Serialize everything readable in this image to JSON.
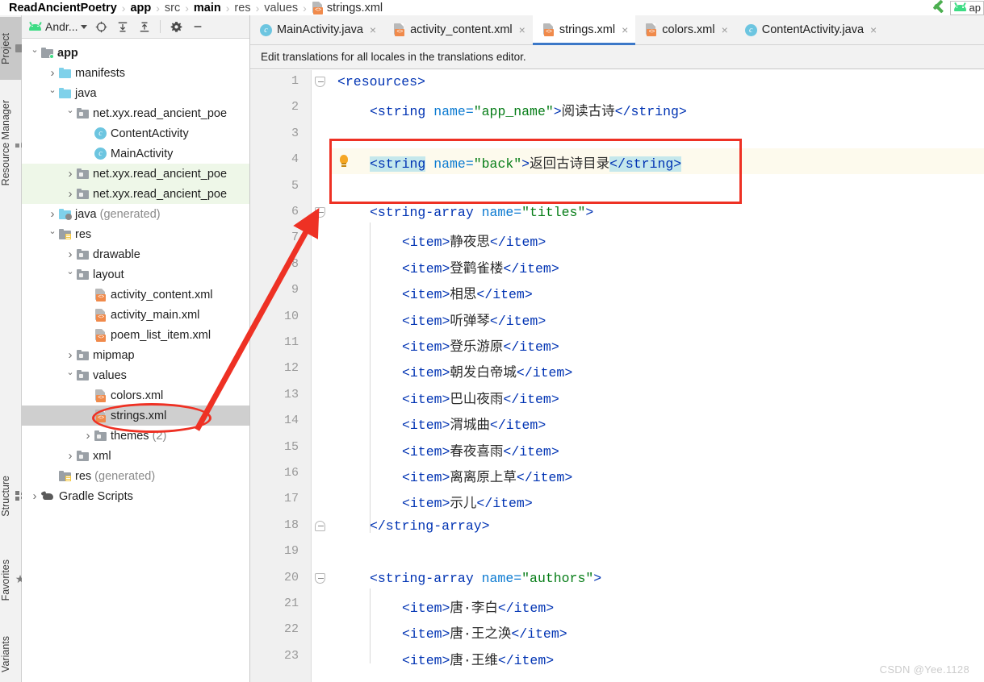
{
  "breadcrumb": {
    "items": [
      {
        "label": "ReadAncientPoetry",
        "style": "bold"
      },
      {
        "label": "app",
        "style": "bold"
      },
      {
        "label": "src",
        "style": "dim"
      },
      {
        "label": "main",
        "style": "bold"
      },
      {
        "label": "res",
        "style": "dim"
      },
      {
        "label": "values",
        "style": "dim"
      }
    ],
    "file": "strings.xml",
    "separator": "›"
  },
  "toolstrip": {
    "top": [
      {
        "label": "Project",
        "icon": "folder-icon",
        "active": true
      },
      {
        "label": "Resource Manager",
        "icon": "resource-icon",
        "active": false
      }
    ],
    "bottom": [
      {
        "label": "Structure",
        "icon": "structure-icon"
      },
      {
        "label": "Favorites",
        "icon": "star-icon"
      },
      {
        "label": "Variants",
        "icon": "none"
      }
    ]
  },
  "project_toolbar": {
    "selector_label": "Andr...",
    "buttons": [
      {
        "name": "locate-icon",
        "glyph": "⊕"
      },
      {
        "name": "expand-all-icon",
        "glyph": "≡"
      },
      {
        "name": "collapse-all-icon",
        "glyph": "≡"
      },
      {
        "name": "settings-gear-icon",
        "glyph": "⚙"
      },
      {
        "name": "hide-panel-icon",
        "glyph": "−"
      }
    ]
  },
  "tree": [
    {
      "indent": 0,
      "arrow": "open",
      "icon": "module-folder",
      "label": "app",
      "bold": true,
      "state": "normal"
    },
    {
      "indent": 1,
      "arrow": "closed",
      "icon": "folder-blue",
      "label": "manifests",
      "bold": false,
      "state": "normal"
    },
    {
      "indent": 1,
      "arrow": "open",
      "icon": "folder-blue",
      "label": "java",
      "bold": false,
      "state": "normal"
    },
    {
      "indent": 2,
      "arrow": "open",
      "icon": "package",
      "label": "net.xyx.read_ancient_poe",
      "bold": false,
      "state": "normal"
    },
    {
      "indent": 3,
      "arrow": "none",
      "icon": "java-class",
      "label": "ContentActivity",
      "bold": false,
      "state": "normal"
    },
    {
      "indent": 3,
      "arrow": "none",
      "icon": "java-class",
      "label": "MainActivity",
      "bold": false,
      "state": "normal"
    },
    {
      "indent": 2,
      "arrow": "closed",
      "icon": "package",
      "label": "net.xyx.read_ancient_poe",
      "bold": false,
      "state": "green"
    },
    {
      "indent": 2,
      "arrow": "closed",
      "icon": "package",
      "label": "net.xyx.read_ancient_poe",
      "bold": false,
      "state": "green"
    },
    {
      "indent": 1,
      "arrow": "closed",
      "icon": "folder-gen",
      "label": "java",
      "suffix": " (generated)",
      "bold": false,
      "state": "normal"
    },
    {
      "indent": 1,
      "arrow": "open",
      "icon": "folder-res",
      "label": "res",
      "bold": false,
      "state": "normal"
    },
    {
      "indent": 2,
      "arrow": "closed",
      "icon": "package",
      "label": "drawable",
      "bold": false,
      "state": "normal"
    },
    {
      "indent": 2,
      "arrow": "open",
      "icon": "package",
      "label": "layout",
      "bold": false,
      "state": "normal"
    },
    {
      "indent": 3,
      "arrow": "none",
      "icon": "xml-file",
      "label": "activity_content.xml",
      "bold": false,
      "state": "normal"
    },
    {
      "indent": 3,
      "arrow": "none",
      "icon": "xml-file",
      "label": "activity_main.xml",
      "bold": false,
      "state": "normal"
    },
    {
      "indent": 3,
      "arrow": "none",
      "icon": "xml-file",
      "label": "poem_list_item.xml",
      "bold": false,
      "state": "normal"
    },
    {
      "indent": 2,
      "arrow": "closed",
      "icon": "package",
      "label": "mipmap",
      "bold": false,
      "state": "normal"
    },
    {
      "indent": 2,
      "arrow": "open",
      "icon": "package",
      "label": "values",
      "bold": false,
      "state": "normal"
    },
    {
      "indent": 3,
      "arrow": "none",
      "icon": "xml-file",
      "label": "colors.xml",
      "bold": false,
      "state": "normal"
    },
    {
      "indent": 3,
      "arrow": "none",
      "icon": "xml-file",
      "label": "strings.xml",
      "bold": false,
      "state": "selected"
    },
    {
      "indent": 3,
      "arrow": "closed",
      "icon": "package",
      "label": "themes",
      "suffix": " (2)",
      "bold": false,
      "state": "normal"
    },
    {
      "indent": 2,
      "arrow": "closed",
      "icon": "package",
      "label": "xml",
      "bold": false,
      "state": "normal"
    },
    {
      "indent": 1,
      "arrow": "none",
      "icon": "folder-res",
      "label": "res",
      "suffix": " (generated)",
      "bold": false,
      "state": "normal"
    },
    {
      "indent": 0,
      "arrow": "closed",
      "icon": "gradle",
      "label": "Gradle Scripts",
      "bold": false,
      "state": "normal"
    }
  ],
  "editor_tabs": [
    {
      "label": "MainActivity.java",
      "icon": "java-class",
      "active": false
    },
    {
      "label": "activity_content.xml",
      "icon": "xml-file",
      "active": false
    },
    {
      "label": "strings.xml",
      "icon": "xml-file",
      "active": true
    },
    {
      "label": "colors.xml",
      "icon": "xml-file",
      "active": false
    },
    {
      "label": "ContentActivity.java",
      "icon": "java-class",
      "active": false
    }
  ],
  "notice": "Edit translations for all locales in the translations editor.",
  "code": {
    "highlighted_line": 4,
    "first_line": 1,
    "last_line": 23,
    "lines": [
      {
        "n": 1,
        "indent": 0,
        "fold": "top",
        "tokens": [
          {
            "t": "<resources>",
            "c": "t-tag"
          }
        ]
      },
      {
        "n": 2,
        "indent": 1,
        "tokens": [
          {
            "t": "<string ",
            "c": "t-tag"
          },
          {
            "t": "name=",
            "c": "t-attr"
          },
          {
            "t": "\"app_name\"",
            "c": "t-val"
          },
          {
            "t": ">",
            "c": "t-tag"
          },
          {
            "t": "阅读古诗",
            "c": "t-text"
          },
          {
            "t": "</string>",
            "c": "t-tag"
          }
        ]
      },
      {
        "n": 3,
        "indent": 0,
        "tokens": []
      },
      {
        "n": 4,
        "indent": 1,
        "bulb": true,
        "tokens": [
          {
            "t": "<string",
            "c": "t-tag",
            "hl": true
          },
          {
            "t": " ",
            "c": "t-tag"
          },
          {
            "t": "name=",
            "c": "t-attr"
          },
          {
            "t": "\"back\"",
            "c": "t-val"
          },
          {
            "t": ">",
            "c": "t-tag"
          },
          {
            "t": "返回古诗目录",
            "c": "t-text"
          },
          {
            "t": "</string>",
            "c": "t-tag",
            "hl": true
          }
        ]
      },
      {
        "n": 5,
        "indent": 0,
        "tokens": []
      },
      {
        "n": 6,
        "indent": 1,
        "fold": "top",
        "tokens": [
          {
            "t": "<string-array ",
            "c": "t-tag"
          },
          {
            "t": "name=",
            "c": "t-attr"
          },
          {
            "t": "\"titles\"",
            "c": "t-val"
          },
          {
            "t": ">",
            "c": "t-tag"
          }
        ]
      },
      {
        "n": 7,
        "indent": 2,
        "tokens": [
          {
            "t": "<item>",
            "c": "t-tag"
          },
          {
            "t": "静夜思",
            "c": "t-text"
          },
          {
            "t": "</item>",
            "c": "t-tag"
          }
        ]
      },
      {
        "n": 8,
        "indent": 2,
        "tokens": [
          {
            "t": "<item>",
            "c": "t-tag"
          },
          {
            "t": "登鹳雀楼",
            "c": "t-text"
          },
          {
            "t": "</item>",
            "c": "t-tag"
          }
        ]
      },
      {
        "n": 9,
        "indent": 2,
        "tokens": [
          {
            "t": "<item>",
            "c": "t-tag"
          },
          {
            "t": "相思",
            "c": "t-text"
          },
          {
            "t": "</item>",
            "c": "t-tag"
          }
        ]
      },
      {
        "n": 10,
        "indent": 2,
        "tokens": [
          {
            "t": "<item>",
            "c": "t-tag"
          },
          {
            "t": "听弹琴",
            "c": "t-text"
          },
          {
            "t": "</item>",
            "c": "t-tag"
          }
        ]
      },
      {
        "n": 11,
        "indent": 2,
        "tokens": [
          {
            "t": "<item>",
            "c": "t-tag"
          },
          {
            "t": "登乐游原",
            "c": "t-text"
          },
          {
            "t": "</item>",
            "c": "t-tag"
          }
        ]
      },
      {
        "n": 12,
        "indent": 2,
        "tokens": [
          {
            "t": "<item>",
            "c": "t-tag"
          },
          {
            "t": "朝发白帝城",
            "c": "t-text"
          },
          {
            "t": "</item>",
            "c": "t-tag"
          }
        ]
      },
      {
        "n": 13,
        "indent": 2,
        "tokens": [
          {
            "t": "<item>",
            "c": "t-tag"
          },
          {
            "t": "巴山夜雨",
            "c": "t-text"
          },
          {
            "t": "</item>",
            "c": "t-tag"
          }
        ]
      },
      {
        "n": 14,
        "indent": 2,
        "tokens": [
          {
            "t": "<item>",
            "c": "t-tag"
          },
          {
            "t": "渭城曲",
            "c": "t-text"
          },
          {
            "t": "</item>",
            "c": "t-tag"
          }
        ]
      },
      {
        "n": 15,
        "indent": 2,
        "tokens": [
          {
            "t": "<item>",
            "c": "t-tag"
          },
          {
            "t": "春夜喜雨",
            "c": "t-text"
          },
          {
            "t": "</item>",
            "c": "t-tag"
          }
        ]
      },
      {
        "n": 16,
        "indent": 2,
        "tokens": [
          {
            "t": "<item>",
            "c": "t-tag"
          },
          {
            "t": "离离原上草",
            "c": "t-text"
          },
          {
            "t": "</item>",
            "c": "t-tag"
          }
        ]
      },
      {
        "n": 17,
        "indent": 2,
        "tokens": [
          {
            "t": "<item>",
            "c": "t-tag"
          },
          {
            "t": "示儿",
            "c": "t-text"
          },
          {
            "t": "</item>",
            "c": "t-tag"
          }
        ]
      },
      {
        "n": 18,
        "indent": 1,
        "fold": "bot",
        "tokens": [
          {
            "t": "</string-array>",
            "c": "t-tag"
          }
        ]
      },
      {
        "n": 19,
        "indent": 0,
        "tokens": []
      },
      {
        "n": 20,
        "indent": 1,
        "fold": "top",
        "tokens": [
          {
            "t": "<string-array ",
            "c": "t-tag"
          },
          {
            "t": "name=",
            "c": "t-attr"
          },
          {
            "t": "\"authors\"",
            "c": "t-val"
          },
          {
            "t": ">",
            "c": "t-tag"
          }
        ]
      },
      {
        "n": 21,
        "indent": 2,
        "tokens": [
          {
            "t": "<item>",
            "c": "t-tag"
          },
          {
            "t": "唐·李白",
            "c": "t-text"
          },
          {
            "t": "</item>",
            "c": "t-tag"
          }
        ]
      },
      {
        "n": 22,
        "indent": 2,
        "tokens": [
          {
            "t": "<item>",
            "c": "t-tag"
          },
          {
            "t": "唐·王之涣",
            "c": "t-text"
          },
          {
            "t": "</item>",
            "c": "t-tag"
          }
        ]
      },
      {
        "n": 23,
        "indent": 2,
        "tokens": [
          {
            "t": "<item>",
            "c": "t-tag"
          },
          {
            "t": "唐·王维",
            "c": "t-text"
          },
          {
            "t": "</item>",
            "c": "t-tag"
          }
        ]
      }
    ]
  },
  "annotations": {
    "rect_color": "#ee3124",
    "ellipse_color": "#ee3124",
    "arrow_color": "#ee3124"
  },
  "watermark": "CSDN @Yee.1128",
  "colors": {
    "accent_tab": "#3c78c8",
    "panel_bg": "#f2f2f2",
    "selection_gray": "#cfcfcf",
    "test_source_green": "#eef7e8",
    "line_highlight": "#fdfaed",
    "tag_highlight": "#c5e8ec",
    "xml_tag_blue": "#0033b3",
    "xml_attr_blue": "#0b7ad1",
    "xml_value_green": "#067d17"
  }
}
